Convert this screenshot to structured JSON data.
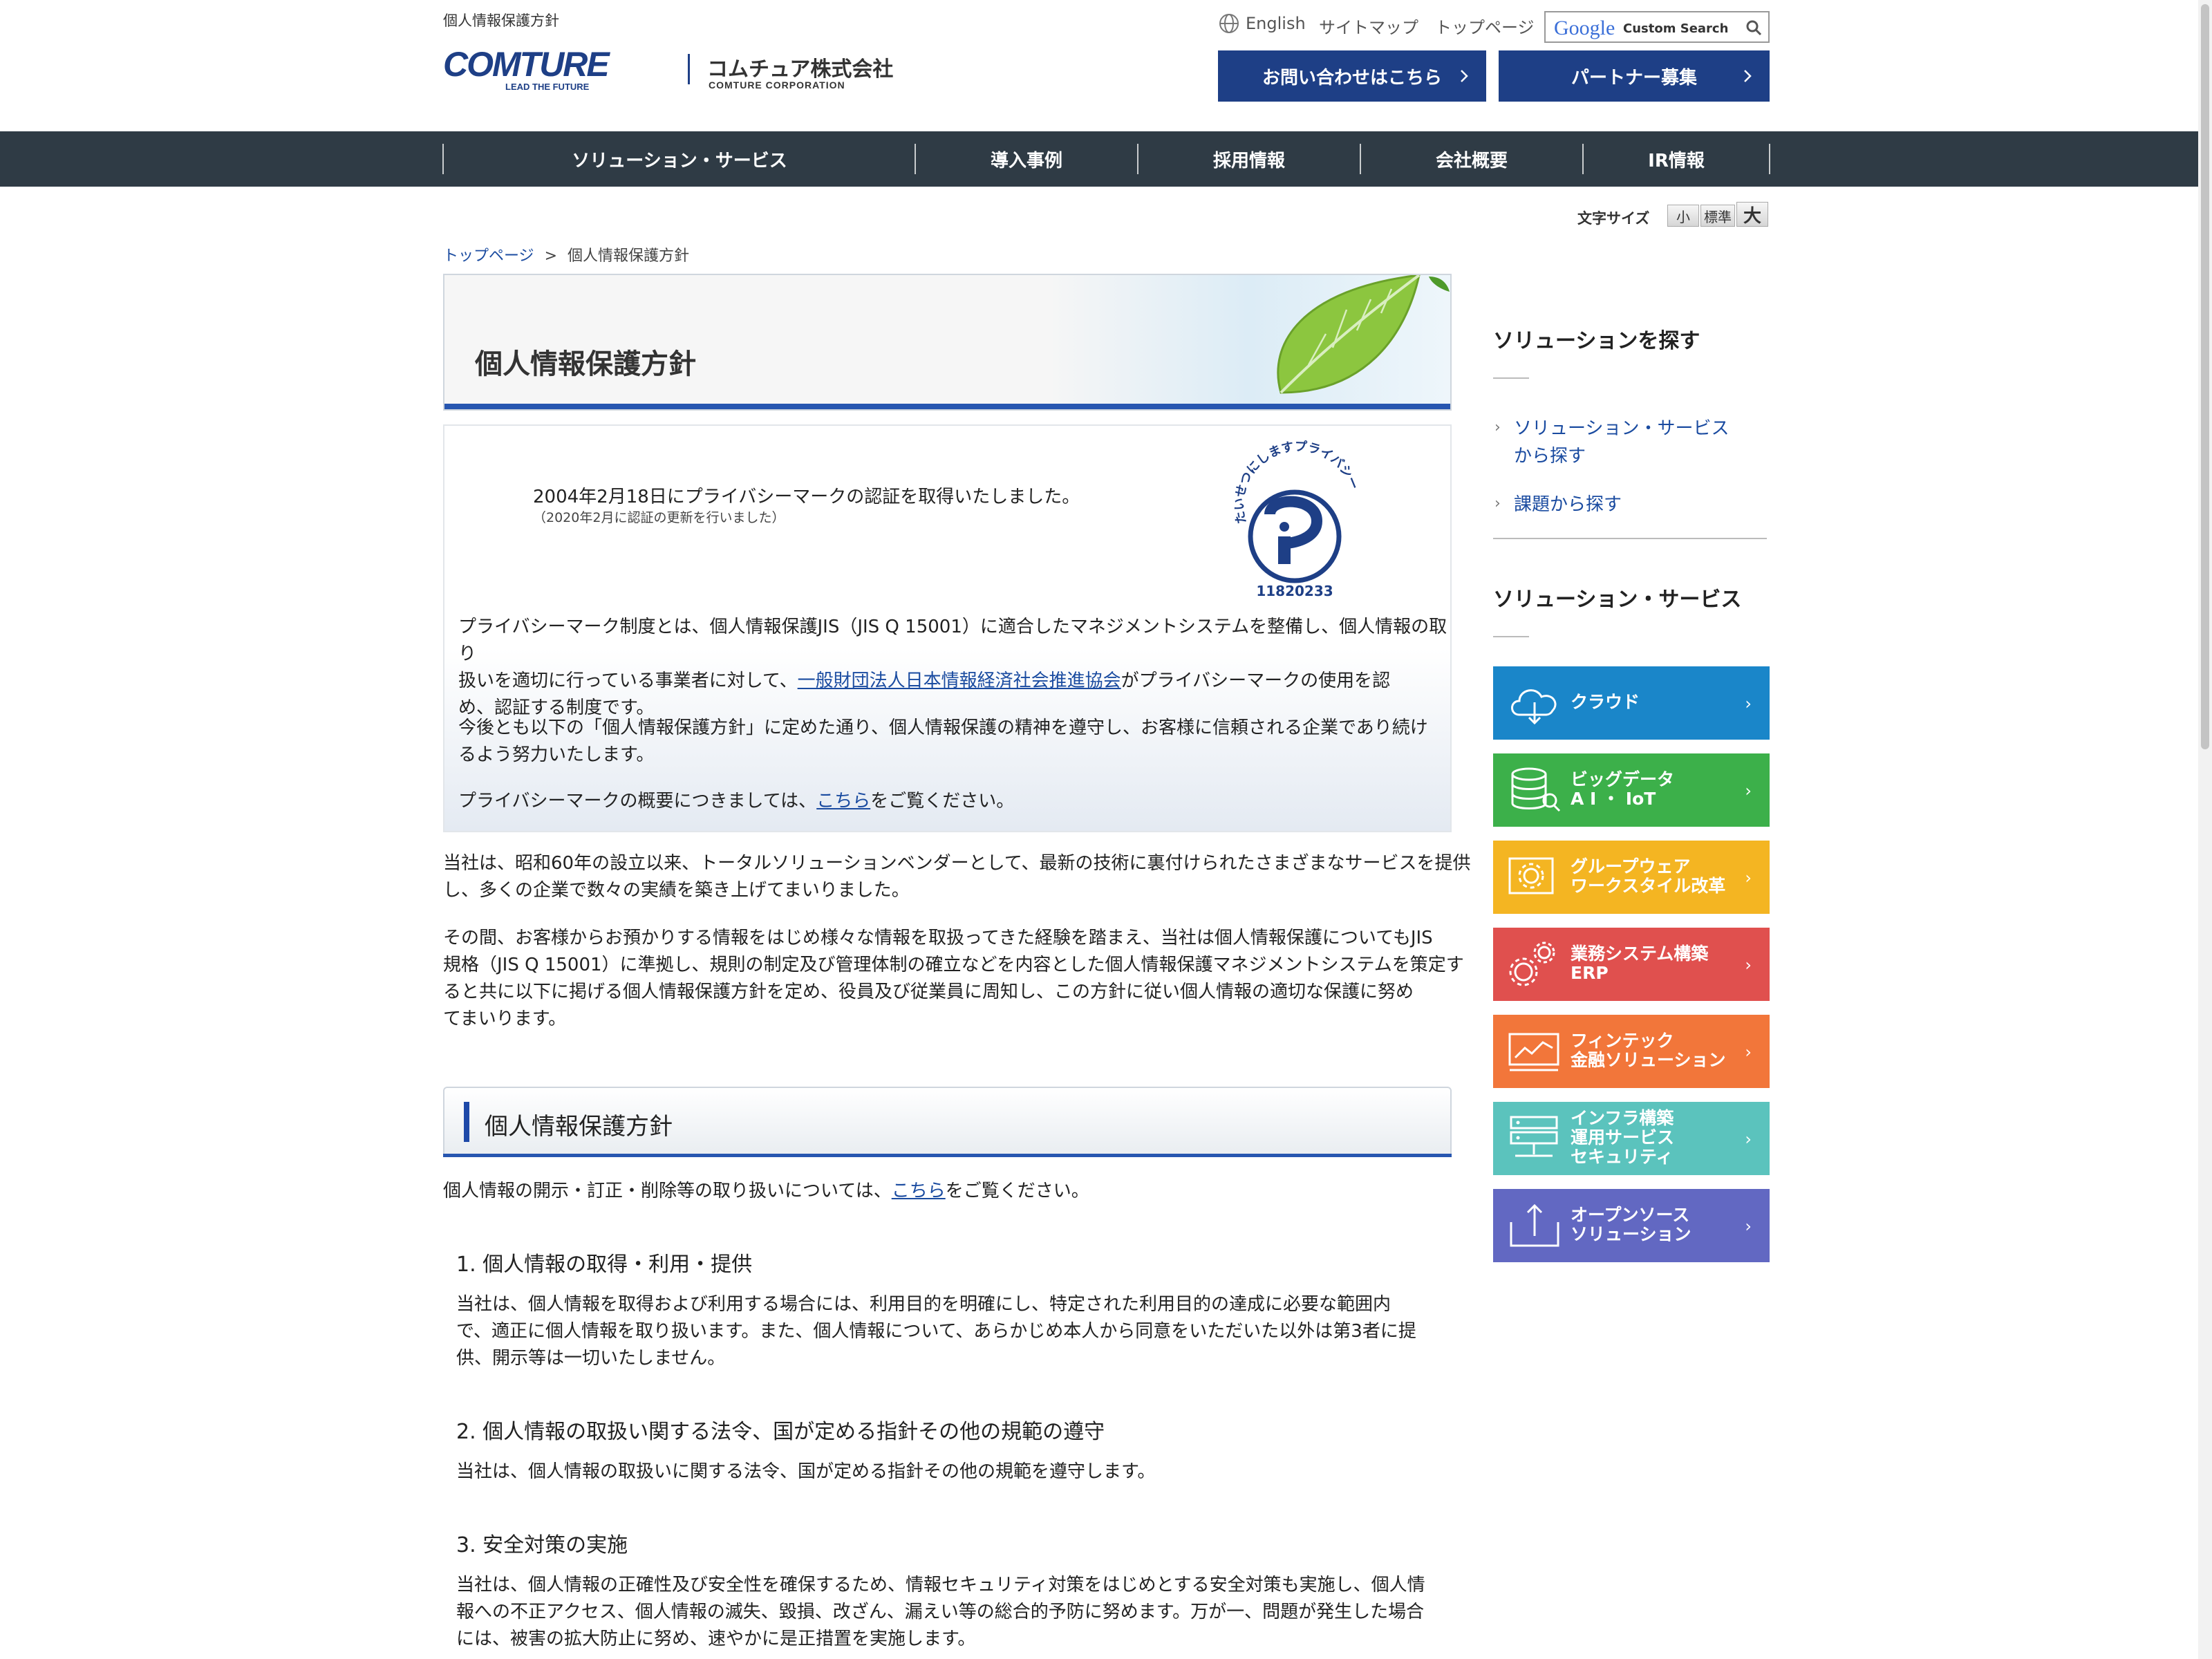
{
  "header": {
    "tagline": "個人情報保護方針",
    "logo_main": "COMTURE",
    "logo_sub": "LEAD THE FUTURE",
    "logo_jp": "コムチュア株式会社",
    "logo_en": "COMTURE CORPORATION",
    "english_label": "English",
    "sitemap_label": "サイトマップ",
    "top_label": "トップページ",
    "search_brand": "Google",
    "search_text": "Custom Search",
    "contact_button": "お問い合わせはこちら",
    "partner_button": "パートナー募集"
  },
  "nav": {
    "items": [
      "ソリューション・サービス",
      "導入事例",
      "採用情報",
      "会社概要",
      "IR情報"
    ]
  },
  "font_size": {
    "label": "文字サイズ",
    "small": "小",
    "standard": "標準",
    "large": "大"
  },
  "breadcrumb": {
    "home": "トップページ",
    "separator": ">",
    "current": "個人情報保護方針"
  },
  "page_title": "個人情報保護方針",
  "privacy_box": {
    "cert_line": "2004年2月18日にプライバシーマークの認証を取得いたしました。",
    "renewal_line": "（2020年2月に認証の更新を行いました）",
    "mark_arc_text": "たいせつにしますプライバシー",
    "mark_number": "11820233",
    "p1_line1": "プライバシーマーク制度とは、個人情報保護JIS（JIS Q 15001）に適合したマネジメントシステムを整備し、個人情報の取り",
    "p1_line2_pre": "扱いを適切に行っている事業者に対して、",
    "p1_link": "一般財団法人日本情報経済社会推進協会",
    "p1_line2_post": "がプライバシーマークの使用を認",
    "p1_line3": "め、認証する制度です。",
    "p2_line1": "今後とも以下の「個人情報保護方針」に定めた通り、個人情報保護の精神を遵守し、お客様に信頼される企業であり続け",
    "p2_line2": "るよう努力いたします。",
    "p3_pre": "プライバシーマークの概要につきましては、",
    "p3_link": "こちら",
    "p3_post": "をご覧ください。"
  },
  "intro": {
    "para1_line1": "当社は、昭和60年の設立以来、トータルソリューションベンダーとして、最新の技術に裏付けられたさまざまなサービスを提供",
    "para1_line2": "し、多くの企業で数々の実績を築き上げてまいりました。",
    "para2_line1": "その間、お客様からお預かりする情報をはじめ様々な情報を取扱ってきた経験を踏まえ、当社は個人情報保護についてもJIS",
    "para2_line2": "規格（JIS Q 15001）に準拠し、規則の制定及び管理体制の確立などを内容とした個人情報保護マネジメントシステムを策定す",
    "para2_line3": "ると共に以下に掲げる個人情報保護方針を定め、役員及び従業員に周知し、この方針に従い個人情報の適切な保護に努め",
    "para2_line4": "てまいります。"
  },
  "policy": {
    "section_title": "個人情報保護方針",
    "disclosure_pre": "個人情報の開示・訂正・削除等の取り扱いについては、",
    "disclosure_link": "こちら",
    "disclosure_post": "をご覧ください。",
    "items": [
      {
        "heading": "1. 個人情報の取得・利用・提供",
        "lines": [
          "当社は、個人情報を取得および利用する場合には、利用目的を明確にし、特定された利用目的の達成に必要な範囲内",
          "で、適正に個人情報を取り扱います。また、個人情報について、あらかじめ本人から同意をいただいた以外は第3者に提",
          "供、開示等は一切いたしません。"
        ]
      },
      {
        "heading": "2. 個人情報の取扱い関する法令、国が定める指針その他の規範の遵守",
        "lines": [
          "当社は、個人情報の取扱いに関する法令、国が定める指針その他の規範を遵守します。"
        ]
      },
      {
        "heading": "3. 安全対策の実施",
        "lines": [
          "当社は、個人情報の正確性及び安全性を確保するため、情報セキュリティ対策をはじめとする安全対策も実施し、個人情",
          "報への不正アクセス、個人情報の滅失、毀損、改ざん、漏えい等の総合的予防に努めます。万が一、問題が発生した場合",
          "には、被害の拡大防止に努め、速やかに是正措置を実施します。"
        ]
      }
    ]
  },
  "sidebar": {
    "find_title": "ソリューションを探す",
    "find_links": [
      "ソリューション・サービス",
      "から探す",
      "課題から探す"
    ],
    "services_title": "ソリューション・サービス",
    "tiles": [
      {
        "line1": "クラウド",
        "line2": "",
        "line3": "",
        "color": "#1a86c9",
        "icon": "cloud-icon"
      },
      {
        "line1": "ビッグデータ",
        "line2": "A I ・ IoT",
        "line3": "",
        "color": "#3cb04a",
        "icon": "database-icon"
      },
      {
        "line1": "グループウェア",
        "line2": "ワークスタイル改革",
        "line3": "",
        "color": "#f4b522",
        "icon": "gear-icon"
      },
      {
        "line1": "業務システム構築",
        "line2": "ERP",
        "line3": "",
        "color": "#e0504e",
        "icon": "gears-icon"
      },
      {
        "line1": "フィンテック",
        "line2": "金融ソリューション",
        "line3": "",
        "color": "#f2763a",
        "icon": "chart-icon"
      },
      {
        "line1": "インフラ構築",
        "line2": "運用サービス",
        "line3": "セキュリティ",
        "color": "#5bc3bd",
        "icon": "server-icon"
      },
      {
        "line1": "オープンソース",
        "line2": "ソリューション",
        "line3": "",
        "color": "#6268c2",
        "icon": "upload-icon"
      }
    ]
  }
}
